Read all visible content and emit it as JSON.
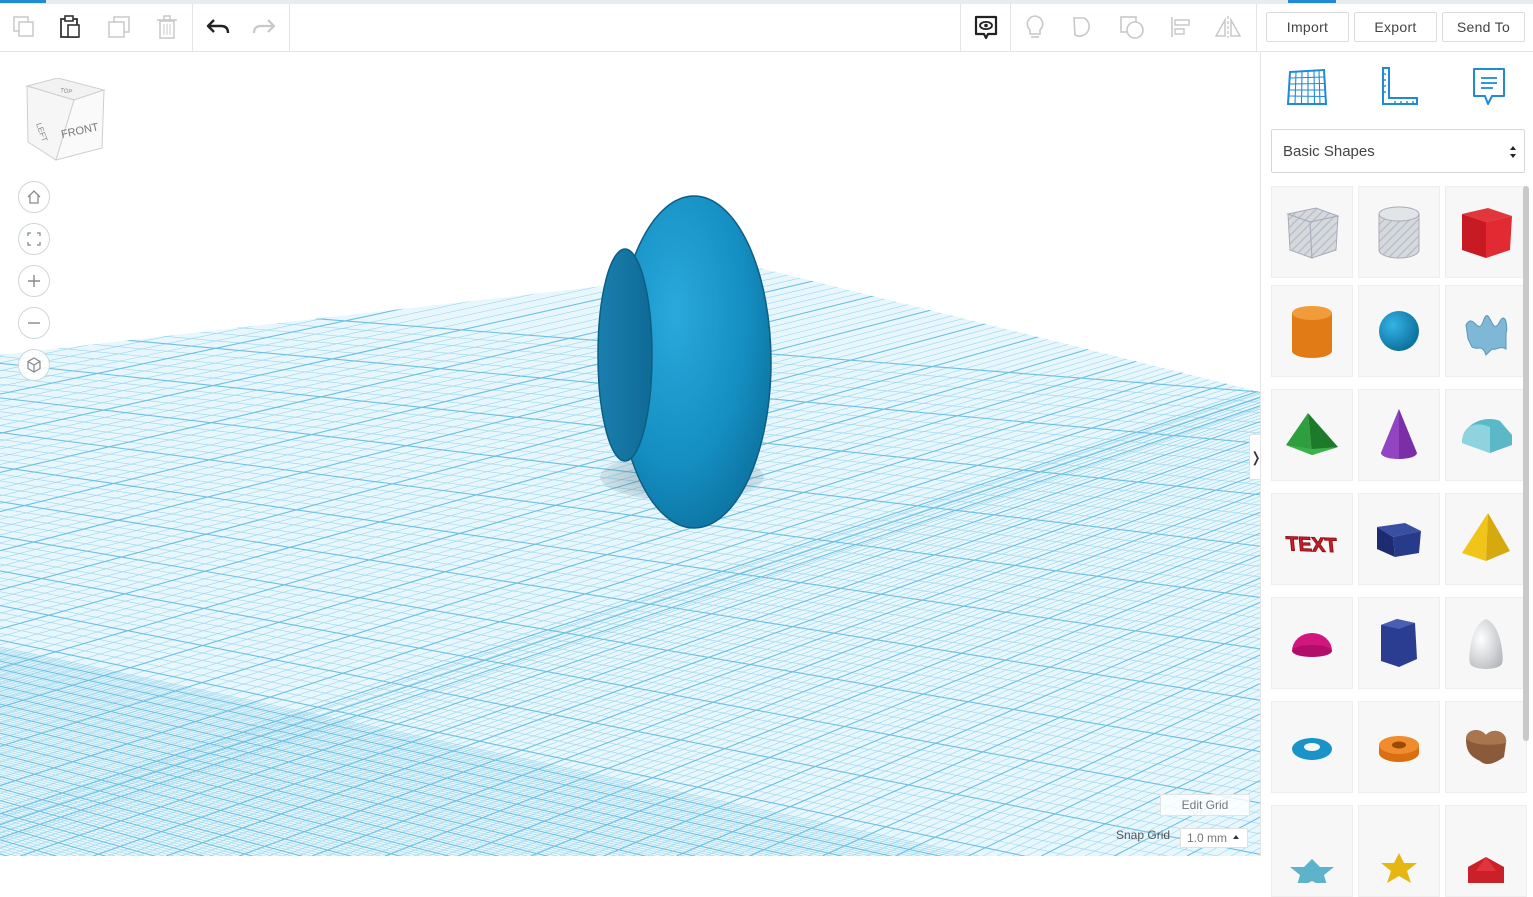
{
  "toolbar": {
    "left_icons": [
      "copy-icon",
      "paste-icon",
      "duplicate-icon",
      "delete-icon",
      "undo-icon",
      "redo-icon"
    ],
    "right_icons": [
      "show-notes-icon",
      "lightbulb-icon",
      "group-icon",
      "ungroup-icon",
      "align-icon",
      "mirror-icon"
    ],
    "import_label": "Import",
    "export_label": "Export",
    "send_to_label": "Send To"
  },
  "viewcube": {
    "front_label": "FRONT",
    "left_label": "LEFT",
    "top_label": "TOP"
  },
  "nav_controls": [
    "home-view-icon",
    "fit-view-icon",
    "zoom-in-icon",
    "zoom-out-icon",
    "ortho-view-icon"
  ],
  "panel": {
    "icons": [
      "workplane-grid-icon",
      "ruler-icon",
      "notes-icon"
    ],
    "category": "Basic Shapes",
    "shapes": [
      "box-hole",
      "cylinder-hole",
      "box",
      "cylinder",
      "sphere",
      "scribble",
      "roof",
      "cone",
      "round-roof",
      "text",
      "half-cylinder-wedge",
      "pyramid",
      "half-sphere",
      "polygon",
      "paraboloid",
      "torus",
      "tube",
      "heart",
      "star",
      "star-gold",
      "icosahedron"
    ]
  },
  "grid": {
    "edit_label": "Edit Grid",
    "snap_label": "Snap Grid",
    "snap_value": "1.0 mm"
  },
  "colors": {
    "grid_line": "#8fd0ea",
    "grid_bg": "#e6f6fd",
    "shape_blue": "#1a8fc0",
    "accent": "#1f8bd6"
  }
}
